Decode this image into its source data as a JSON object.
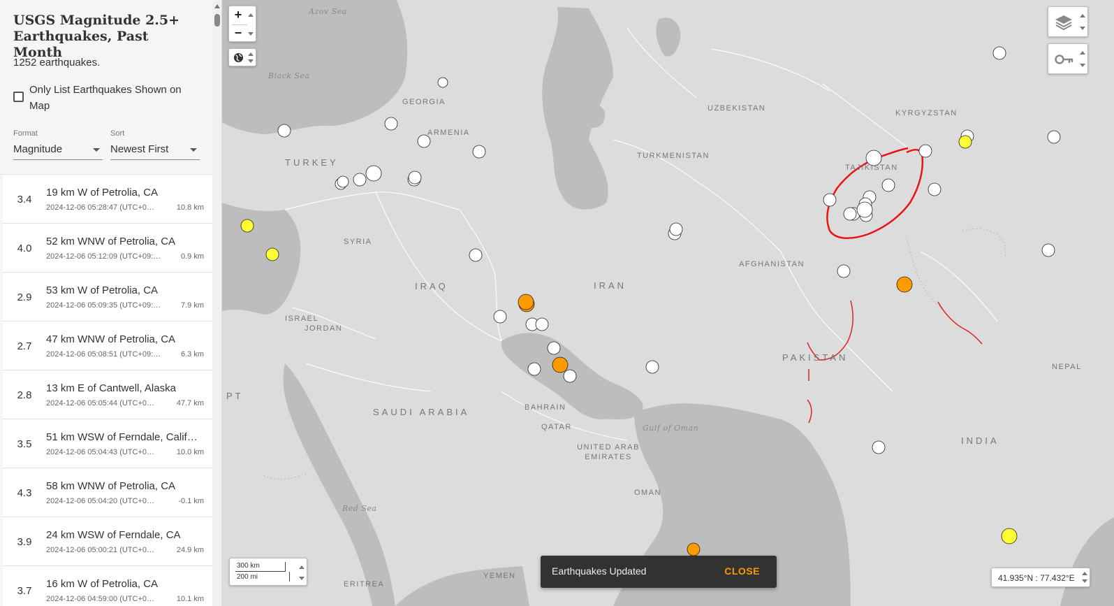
{
  "sidebar": {
    "title": "USGS Magnitude 2.5+ Earthquakes, Past Month",
    "count": "1252 earthquakes.",
    "only_list_label": "Only List Earthquakes Shown on Map",
    "format_label": "Format",
    "format_value": "Magnitude",
    "sort_label": "Sort",
    "sort_value": "Newest First"
  },
  "earthquakes": [
    {
      "mag": "3.4",
      "place": "19 km W of Petrolia, CA",
      "time": "2024-12-06 05:28:47 (UTC+0…",
      "depth": "10.8 km"
    },
    {
      "mag": "4.0",
      "place": "52 km WNW of Petrolia, CA",
      "time": "2024-12-06 05:12:09 (UTC+09:…",
      "depth": "0.9 km"
    },
    {
      "mag": "2.9",
      "place": "53 km W of Petrolia, CA",
      "time": "2024-12-06 05:09:35 (UTC+09:…",
      "depth": "7.9 km"
    },
    {
      "mag": "2.7",
      "place": "47 km WNW of Petrolia, CA",
      "time": "2024-12-06 05:08:51 (UTC+09:…",
      "depth": "6.3 km"
    },
    {
      "mag": "2.8",
      "place": "13 km E of Cantwell, Alaska",
      "time": "2024-12-06 05:05:44 (UTC+0…",
      "depth": "47.7 km"
    },
    {
      "mag": "3.5",
      "place": "51 km WSW of Ferndale, Calif…",
      "time": "2024-12-06 05:04:43 (UTC+0…",
      "depth": "10.0 km"
    },
    {
      "mag": "4.3",
      "place": "58 km WNW of Petrolia, CA",
      "time": "2024-12-06 05:04:20 (UTC+0…",
      "depth": "-0.1 km"
    },
    {
      "mag": "3.9",
      "place": "24 km WSW of Ferndale, CA",
      "time": "2024-12-06 05:00:21 (UTC+0…",
      "depth": "24.9 km"
    },
    {
      "mag": "3.7",
      "place": "16 km W of Petrolia, CA",
      "time": "2024-12-06 04:59:00 (UTC+0…",
      "depth": "10.1 km"
    }
  ],
  "map": {
    "labels": {
      "azov": "Azov Sea",
      "black_sea": "Black Sea",
      "georgia": "GEORGIA",
      "armenia": "ARMENIA",
      "turkey": "TURKEY",
      "syria": "SYRIA",
      "iraq": "IRAQ",
      "iran": "IRAN",
      "israel": "ISRAEL",
      "jordan": "JORDAN",
      "egypt": "PT",
      "saudi": "SAUDI ARABIA",
      "bahrain": "BAHRAIN",
      "qatar": "QATAR",
      "uae": "UNITED ARAB EMIRATES",
      "oman": "OMAN",
      "gulf_oman": "Gulf of Oman",
      "red_sea": "Red Sea",
      "yemen": "YEMEN",
      "eritrea": "ERITREA",
      "uzbekistan": "UZBEKISTAN",
      "turkmenistan": "TURKMENISTAN",
      "kyrgyzstan": "KYRGYZSTAN",
      "tajikistan": "TAJIKISTAN",
      "afghanistan": "AFGHANISTAN",
      "pakistan": "PAKISTAN",
      "india": "INDIA",
      "nepal": "NEPAL"
    },
    "zoom_in": "+",
    "zoom_out": "−",
    "scale_km": "300 km",
    "scale_mi": "200 mi",
    "coordinates": "41.935°N : 77.432°E"
  },
  "toast": {
    "message": "Earthquakes Updated",
    "close": "CLOSE"
  },
  "colors": {
    "marker_white": "#ffffff",
    "marker_yellow": "#ffff33",
    "marker_orange": "#ff9900",
    "annotation": "#ee1111",
    "land": "#dcdcdc",
    "water": "#bdbdbd"
  },
  "icons": {
    "zoom_in": "plus-icon",
    "zoom_out": "minus-icon",
    "globe": "globe-icon",
    "layers": "layers-icon",
    "legend": "key-icon"
  }
}
